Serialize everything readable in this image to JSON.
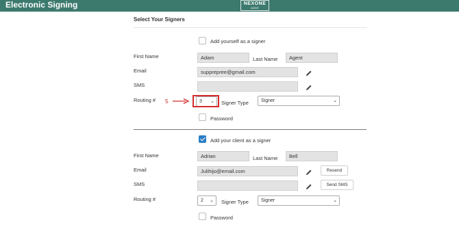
{
  "app": {
    "title": "Electronic Signing",
    "logo_brand": "NEXONE",
    "logo_sub": "AGENT"
  },
  "section": {
    "title": "Select Your Signers"
  },
  "annotation": {
    "step": "5",
    "color": "#d12b2b"
  },
  "accent": "#3d7a6e",
  "signer1": {
    "checkbox_label": "Add yourself as a signer",
    "checked": false,
    "first_name_label": "First Name",
    "first_name": "Adam",
    "last_name_label": "Last Name",
    "last_name": "Agent",
    "email_label": "Email",
    "email": "supprepree@gmail.com",
    "sms_label": "SMS",
    "sms": "",
    "routing_label": "Routing #",
    "routing_value": "3",
    "signer_type_label": "Signer Type",
    "signer_type": "Signer",
    "password_label": "Password"
  },
  "signer2": {
    "checkbox_label": "Add your client as a signer",
    "checked": true,
    "first_name_label": "First Name",
    "first_name": "Adrian",
    "last_name_label": "Last Name",
    "last_name": "Bell",
    "email_label": "Email",
    "email": "Julihijo@email.com",
    "sms_label": "SMS",
    "sms": "",
    "routing_label": "Routing #",
    "routing_value": "2",
    "signer_type_label": "Signer Type",
    "signer_type": "Signer",
    "password_label": "Password",
    "resend_label": "Resend",
    "send_sms_label": "Send SMS"
  }
}
